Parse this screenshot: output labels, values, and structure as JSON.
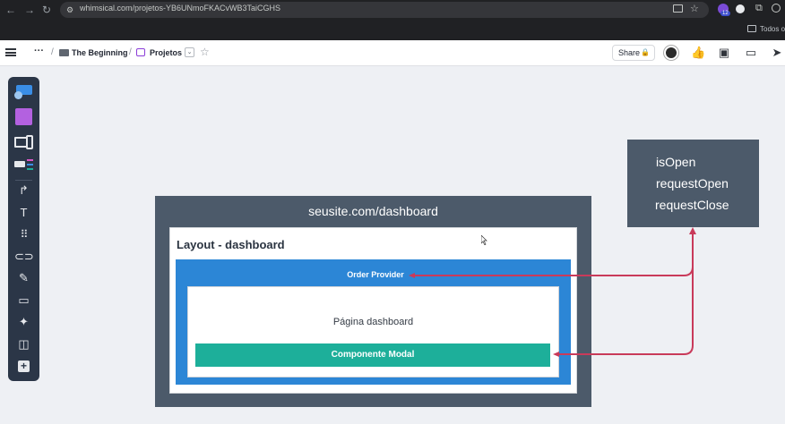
{
  "browser": {
    "url": "whimsical.com/projetos-YB6UNmoFKACvWB3TaiCGHS",
    "bookmarks_label": "Todos os",
    "extension_badge": "12"
  },
  "header": {
    "breadcrumb": [
      "The Beginning",
      "Projetos"
    ],
    "share_label": "Share"
  },
  "diagram": {
    "frame_title": "seusite.com/dashboard",
    "layout_title": "Layout - dashboard",
    "provider_label": "Order Provider",
    "page_label": "Página dashboard",
    "modal_label": "Componente Modal",
    "state_items": [
      "isOpen",
      "requestOpen",
      "requestClose"
    ]
  },
  "colors": {
    "frame": "#4c5a6a",
    "provider": "#2c86d6",
    "modal": "#1daf9a",
    "connector": "#c93a5a",
    "toolbar": "#2b3647"
  },
  "icons": {
    "toolbar": [
      "flowchart-icon",
      "sticky-note-icon",
      "wireframe-icon",
      "mindmap-icon",
      "arrow-icon",
      "text-icon",
      "grid-icon",
      "link-icon",
      "pencil-icon",
      "section-icon",
      "ai-sparkle-icon",
      "table-icon",
      "add-icon"
    ]
  }
}
